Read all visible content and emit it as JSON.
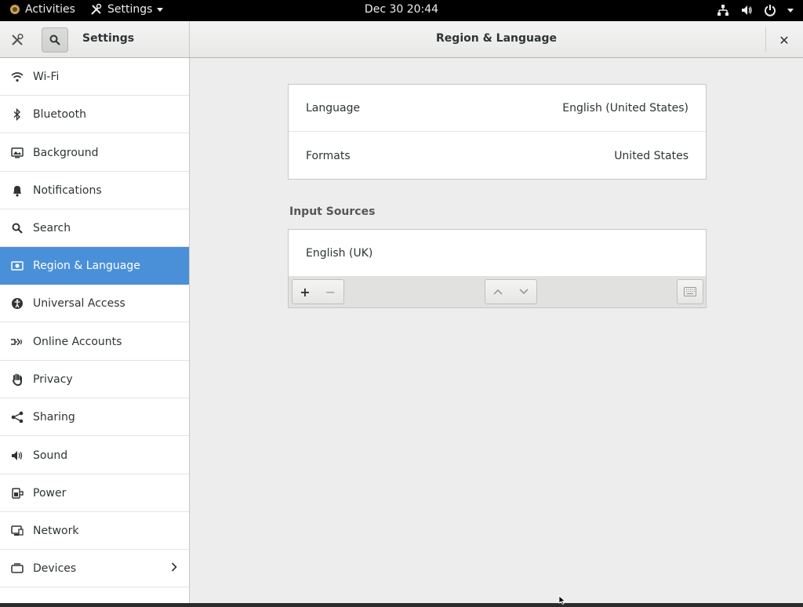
{
  "topbar": {
    "activities": "Activities",
    "app_menu": "Settings",
    "clock": "Dec 30  20:44"
  },
  "header": {
    "app_title": "Settings",
    "page_title": "Region & Language",
    "close_glyph": "✕"
  },
  "sidebar": {
    "items": [
      {
        "label": "Wi-Fi",
        "icon": "wifi-icon"
      },
      {
        "label": "Bluetooth",
        "icon": "bluetooth-icon"
      },
      {
        "label": "Background",
        "icon": "background-icon"
      },
      {
        "label": "Notifications",
        "icon": "bell-icon"
      },
      {
        "label": "Search",
        "icon": "search-icon"
      },
      {
        "label": "Region & Language",
        "icon": "region-icon",
        "selected": true
      },
      {
        "label": "Universal Access",
        "icon": "accessibility-icon"
      },
      {
        "label": "Online Accounts",
        "icon": "online-accounts-icon"
      },
      {
        "label": "Privacy",
        "icon": "hand-icon"
      },
      {
        "label": "Sharing",
        "icon": "share-icon"
      },
      {
        "label": "Sound",
        "icon": "speaker-icon"
      },
      {
        "label": "Power",
        "icon": "battery-icon"
      },
      {
        "label": "Network",
        "icon": "network-icon"
      },
      {
        "label": "Devices",
        "icon": "devices-icon"
      }
    ]
  },
  "main": {
    "language_label": "Language",
    "language_value": "English (United States)",
    "formats_label": "Formats",
    "formats_value": "United States",
    "input_sources_title": "Input Sources",
    "input_sources": [
      "English (UK)"
    ],
    "add_glyph": "+",
    "remove_glyph": "−"
  },
  "colors": {
    "accent": "#4a90d9",
    "topbar": "#000000",
    "background": "#ededed"
  }
}
